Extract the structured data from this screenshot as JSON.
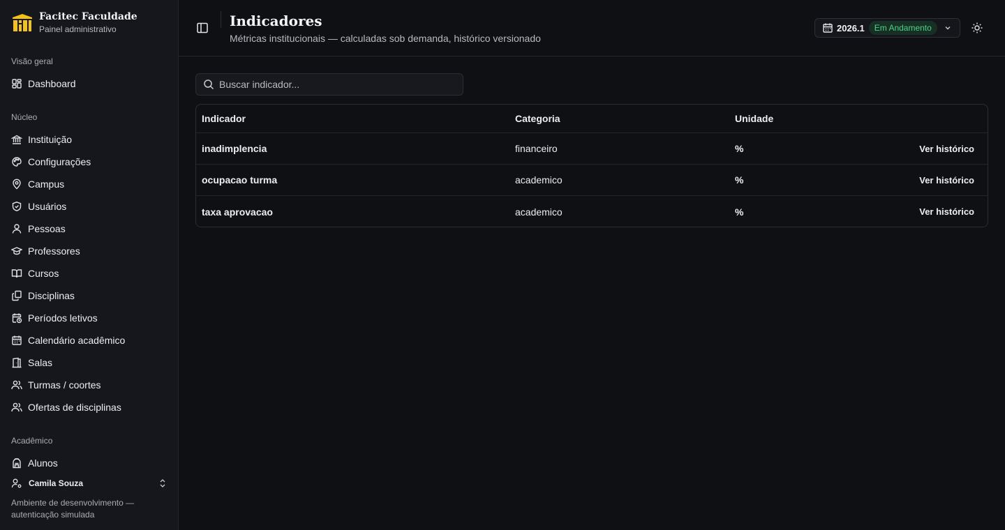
{
  "brand": {
    "name": "Facitec Faculdade",
    "subtitle": "Painel administrativo",
    "logo_color": "#f2c21b"
  },
  "sidebar": {
    "sections": [
      {
        "heading": "Visão geral",
        "items": [
          {
            "label": "Dashboard",
            "icon": "dashboard-icon"
          }
        ]
      },
      {
        "heading": "Núcleo",
        "items": [
          {
            "label": "Instituição",
            "icon": "landmark-icon"
          },
          {
            "label": "Configurações",
            "icon": "palette-icon"
          },
          {
            "label": "Campus",
            "icon": "map-pin-icon"
          },
          {
            "label": "Usuários",
            "icon": "shield-icon"
          },
          {
            "label": "Pessoas",
            "icon": "user-icon"
          },
          {
            "label": "Professores",
            "icon": "graduation-cap-icon"
          },
          {
            "label": "Cursos",
            "icon": "book-open-icon"
          },
          {
            "label": "Disciplinas",
            "icon": "files-icon"
          },
          {
            "label": "Períodos letivos",
            "icon": "calendar-clock-icon"
          },
          {
            "label": "Calendário acadêmico",
            "icon": "calendar-icon"
          },
          {
            "label": "Salas",
            "icon": "door-icon"
          },
          {
            "label": "Turmas / coortes",
            "icon": "users-icon"
          },
          {
            "label": "Ofertas de disciplinas",
            "icon": "users-icon"
          }
        ]
      },
      {
        "heading": "Acadêmico",
        "items": [
          {
            "label": "Alunos",
            "icon": "backpack-icon"
          }
        ]
      }
    ],
    "user": {
      "name": "Camila Souza",
      "icon": "user-cog-icon"
    },
    "env_note": "Ambiente de desenvolvimento — autenticação simulada"
  },
  "header": {
    "title": "Indicadores",
    "subtitle": "Métricas institucionais — calculadas sob demanda, histórico versionado",
    "period": {
      "year": "2026.1",
      "status": "Em Andamento",
      "status_color": "#4fd18b"
    }
  },
  "search": {
    "placeholder": "Buscar indicador..."
  },
  "table": {
    "columns": [
      "Indicador",
      "Categoria",
      "Unidade"
    ],
    "action_label": "Ver histórico",
    "rows": [
      {
        "indicador": "inadimplencia",
        "categoria": "financeiro",
        "unidade": "%"
      },
      {
        "indicador": "ocupacao turma",
        "categoria": "academico",
        "unidade": "%"
      },
      {
        "indicador": "taxa aprovacao",
        "categoria": "academico",
        "unidade": "%"
      }
    ]
  },
  "colors": {
    "background": "#0f1014",
    "sidebar": "#15171c",
    "border": "#2a2d34",
    "accent": "#f2c21b"
  }
}
